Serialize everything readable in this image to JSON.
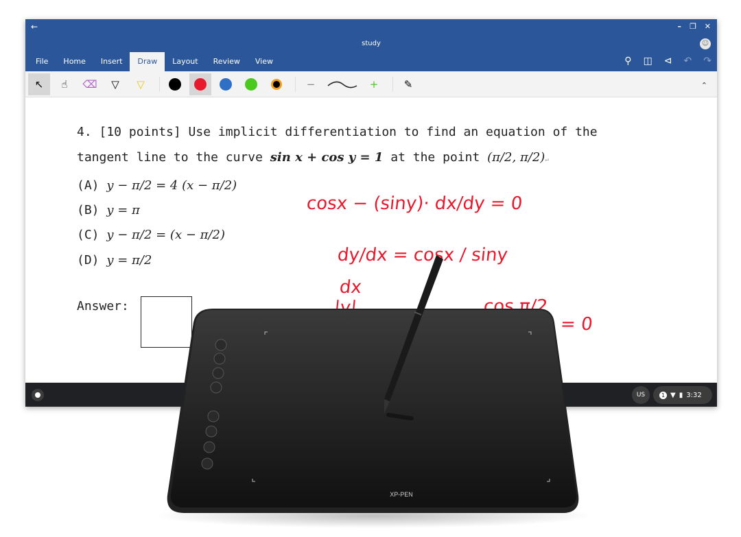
{
  "window": {
    "title": "study",
    "back_icon": "arrow-left-icon",
    "controls": [
      "minimize-icon",
      "restore-icon",
      "close-icon"
    ],
    "account_icon": "account-icon"
  },
  "ribbon": {
    "tabs": [
      {
        "label": "File"
      },
      {
        "label": "Home"
      },
      {
        "label": "Insert"
      },
      {
        "label": "Draw",
        "active": true
      },
      {
        "label": "Layout"
      },
      {
        "label": "Review"
      },
      {
        "label": "View"
      }
    ],
    "right_icons": [
      "lightbulb-icon",
      "read-mode-icon",
      "share-icon",
      "undo-icon",
      "redo-icon"
    ]
  },
  "toolbar": {
    "tools": [
      "select-icon",
      "touch-draw-icon",
      "eraser-icon",
      "pen-icon",
      "highlighter-icon"
    ],
    "colors": [
      {
        "name": "black",
        "hex": "#000000"
      },
      {
        "name": "red",
        "hex": "#e8192c",
        "selected": true
      },
      {
        "name": "blue",
        "hex": "#2f6fc6"
      },
      {
        "name": "green",
        "hex": "#4cc91e"
      }
    ],
    "color_picker_icon": "color-wheel-icon",
    "thickness_minus": "−",
    "thickness_plus": "+",
    "ink_to_shape_icon": "ink-convert-icon",
    "collapse_icon": "chevron-up-icon"
  },
  "document": {
    "line1": "4. [10 points] Use implicit differentiation to find an equation of the",
    "line2a": "tangent line to the curve ",
    "line2m": "sin x + cos y = 1",
    "line2b": " at the point ",
    "line2p": "(π/2, π/2)",
    "options": [
      {
        "label": "(A)",
        "expr": "y − π/2 = 4 (x − π/2)"
      },
      {
        "label": "(B)",
        "expr": "y = π"
      },
      {
        "label": "(C)",
        "expr": "y − π/2 = (x − π/2)"
      },
      {
        "label": "(D)",
        "expr": "y = π/2"
      }
    ],
    "answer_label": "Answer:",
    "ink": [
      "cosx − (siny)· dx/dy = 0",
      "dy/dx = cosx / siny",
      "dx",
      "|y|",
      "cos π/2",
      "= 0"
    ],
    "ink_color": "#e8192c"
  },
  "shelf": {
    "keyboard": "US",
    "notifications": "1",
    "time": "3:32",
    "icons": [
      "launcher-icon",
      "wifi-icon",
      "battery-icon"
    ]
  },
  "device": {
    "brand": "XP-PEN"
  }
}
